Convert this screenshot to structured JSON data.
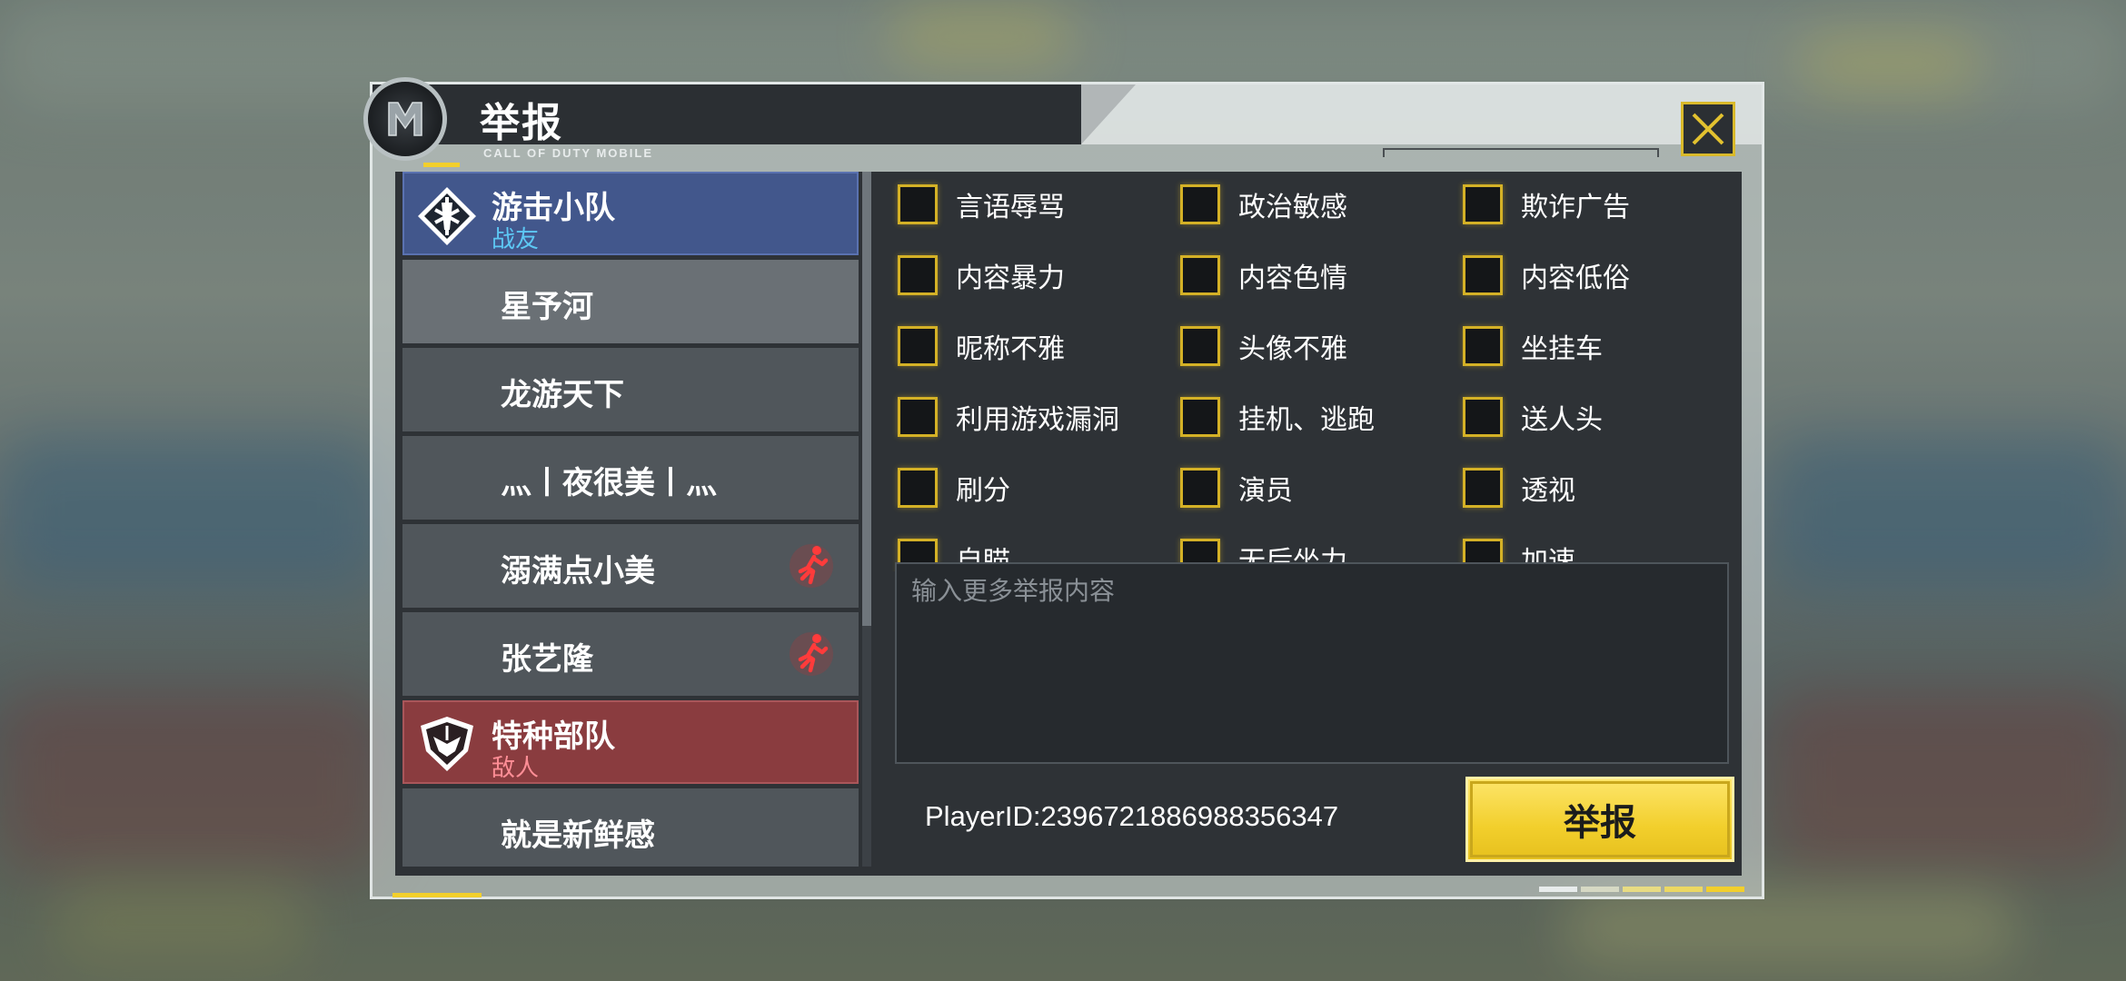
{
  "dialog": {
    "title": "举报",
    "subtitle": "CALL OF DUTY MOBILE"
  },
  "teams": {
    "ally": {
      "name": "游击小队",
      "role": "战友",
      "players": [
        {
          "name": "星予河",
          "left": false
        },
        {
          "name": "龙游天下",
          "left": false
        },
        {
          "name": "灬丨夜很美丨灬",
          "left": false
        },
        {
          "name": "溺满点小美",
          "left": true
        },
        {
          "name": "张艺隆",
          "left": true
        }
      ]
    },
    "enemy": {
      "name": "特种部队",
      "role": "敌人",
      "players": [
        {
          "name": "就是新鲜感",
          "left": false
        }
      ]
    }
  },
  "reasons": [
    [
      "言语辱骂",
      "政治敏感",
      "欺诈广告"
    ],
    [
      "内容暴力",
      "内容色情",
      "内容低俗"
    ],
    [
      "昵称不雅",
      "头像不雅",
      "坐挂车"
    ],
    [
      "利用游戏漏洞",
      "挂机、逃跑",
      "送人头"
    ],
    [
      "刷分",
      "演员",
      "透视"
    ],
    [
      "自瞄",
      "无后坐力",
      "加速"
    ]
  ],
  "input": {
    "placeholder": "输入更多举报内容"
  },
  "player_id": "PlayerID:2396721886988356347",
  "submit_label": "举报",
  "colors": {
    "accent_yellow": "#f2cf2c",
    "ally_blue": "#42578c",
    "enemy_red": "#8a3c3f",
    "panel_dark": "#2e3236"
  }
}
